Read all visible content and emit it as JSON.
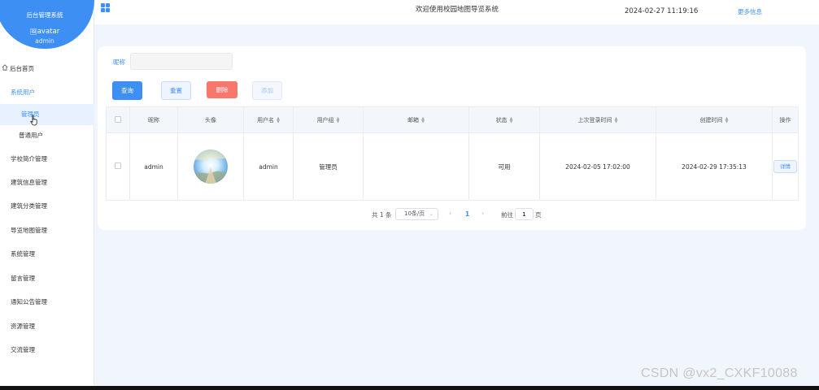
{
  "brand": {
    "title": "后台管理系统",
    "avatar_alt": "avatar",
    "username": "admin"
  },
  "sidebar": {
    "items": [
      {
        "label": "后台首页",
        "icon": "home-icon"
      },
      {
        "label": "系统用户"
      },
      {
        "label": "管理员",
        "active": true
      },
      {
        "label": "普通用户"
      },
      {
        "label": "学校简介管理"
      },
      {
        "label": "建筑信息管理"
      },
      {
        "label": "建筑分类管理"
      },
      {
        "label": "导览地图管理"
      },
      {
        "label": "系统管理"
      },
      {
        "label": "留言管理"
      },
      {
        "label": "通知公告管理"
      },
      {
        "label": "资源管理"
      },
      {
        "label": "交流管理"
      }
    ]
  },
  "header": {
    "title": "欢迎使用校园地图导览系统",
    "datetime": "2024-02-27 11:19:16",
    "more": "更多信息"
  },
  "search": {
    "label": "昵称",
    "value": "",
    "placeholder": ""
  },
  "actions": {
    "query": "查询",
    "reset": "重置",
    "delete": "删除",
    "add": "添加"
  },
  "table": {
    "columns": [
      "昵称",
      "头像",
      "用户名",
      "用户组",
      "邮箱",
      "状态",
      "上次登录时间",
      "创建时间",
      "操作"
    ],
    "rows": [
      {
        "nickname": "admin",
        "username": "admin",
        "group": "管理员",
        "email": "",
        "status": "可用",
        "last_login": "2024-02-05 17:02:00",
        "created": "2024-02-29 17:35:13",
        "action": "详情"
      }
    ]
  },
  "pagination": {
    "total": "共 1 条",
    "page_size": "10条/页",
    "current_page": "1",
    "goto_label": "前往",
    "goto_value": "1",
    "goto_unit": "页"
  },
  "watermark": "CSDN @vx2_CXKF10088",
  "colors": {
    "accent": "#3d8ff4",
    "danger": "#f7776d",
    "page_bg": "#f1f6fc"
  }
}
